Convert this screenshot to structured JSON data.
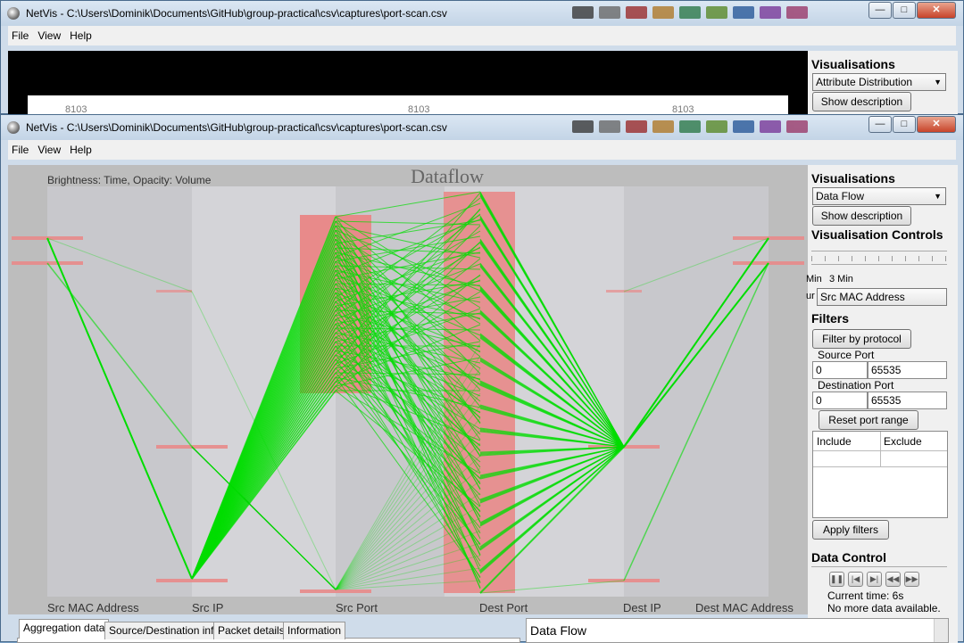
{
  "back_window": {
    "title": "NetVis - C:\\Users\\Dominik\\Documents\\GitHub\\group-practical\\csv\\captures\\port-scan.csv",
    "menu": [
      "File",
      "View",
      "Help"
    ],
    "tick_labels": [
      "8103",
      "8103",
      "8103"
    ],
    "visualisations_title": "Visualisations",
    "vis_select": "Attribute Distribution",
    "show_description": "Show description"
  },
  "front_window": {
    "title": "NetVis - C:\\Users\\Dominik\\Documents\\GitHub\\group-practical\\csv\\captures\\port-scan.csv",
    "menu": [
      "File",
      "View",
      "Help"
    ],
    "window_controls": {
      "minimize": "—",
      "maximize": "□",
      "close": "✕"
    }
  },
  "dataflow": {
    "title": "Dataflow",
    "legend": "Brightness: Time, Opacity: Volume",
    "axes": [
      "Src MAC Address",
      "Src IP",
      "Src Port",
      "Dest Port",
      "Dest IP",
      "Dest MAC Address"
    ],
    "bar_color": "#e88a8a",
    "line_color": "#00dd00"
  },
  "sidebar": {
    "visualisations_title": "Visualisations",
    "vis_select": "Data Flow",
    "show_description": "Show description",
    "controls_title": "Visualisation Controls",
    "slider_min_label": "Min",
    "slider_value_label": "3 Min",
    "colour_label_fragment": "ur",
    "colour_select": "Src MAC Address",
    "filters_title": "Filters",
    "filter_by_protocol": "Filter by protocol",
    "source_port_label": "Source Port",
    "source_port_from": "0",
    "source_port_to": "65535",
    "dest_port_label": "Destination Port",
    "dest_port_from": "0",
    "dest_port_to": "65535",
    "reset_port_range": "Reset port range",
    "include_header": "Include",
    "exclude_header": "Exclude",
    "apply_filters": "Apply filters",
    "data_control_title": "Data Control",
    "current_time": "Current time: 6s",
    "no_more_data": "No more data available."
  },
  "bottom": {
    "tabs": [
      "Aggregation data",
      "Source/Destination info",
      "Packet details",
      "Information"
    ],
    "description_title": "Data Flow"
  }
}
